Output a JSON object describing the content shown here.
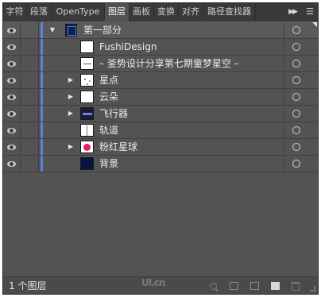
{
  "tabs": [
    {
      "label": "字符",
      "active": false
    },
    {
      "label": "段落",
      "active": false
    },
    {
      "label": "OpenType",
      "active": false
    },
    {
      "label": "图层",
      "active": true
    },
    {
      "label": "画板",
      "active": false
    },
    {
      "label": "变换",
      "active": false
    },
    {
      "label": "对齐",
      "active": false
    },
    {
      "label": "路径查找器",
      "active": false
    }
  ],
  "tab_overflow_icon": "double-chevron-right-icon",
  "panel_menu_icon": "panel-menu-icon",
  "layer_color": "#5c7fe6",
  "layers": [
    {
      "name": "第一部分",
      "level": 0,
      "expanded": true,
      "expandable": true,
      "thumb": "layer-thumb-icon",
      "visible": true
    },
    {
      "name": "FushiDesign",
      "level": 1,
      "expandable": false,
      "thumb": "blank-thumb-icon",
      "visible": true
    },
    {
      "name": "– 釜势设计分享第七期童梦星空 –",
      "level": 1,
      "expandable": false,
      "thumb": "line-thumb-icon",
      "visible": true
    },
    {
      "name": "星点",
      "level": 1,
      "expandable": true,
      "expanded": false,
      "thumb": "dots-thumb-icon",
      "visible": true
    },
    {
      "name": "云朵",
      "level": 1,
      "expandable": true,
      "expanded": false,
      "thumb": "blank-thumb-icon",
      "visible": true
    },
    {
      "name": "飞行器",
      "level": 1,
      "expandable": true,
      "expanded": false,
      "thumb": "ship-thumb-icon",
      "visible": true
    },
    {
      "name": "轨道",
      "level": 1,
      "expandable": false,
      "thumb": "track-thumb-icon",
      "visible": true
    },
    {
      "name": "粉红星球",
      "level": 1,
      "expandable": true,
      "expanded": false,
      "thumb": "planet-thumb-icon",
      "visible": true
    },
    {
      "name": "背景",
      "level": 1,
      "expandable": false,
      "thumb": "bg-thumb-icon",
      "visible": true
    }
  ],
  "footer": {
    "layer_count": "1 个图层",
    "watermark": "UI.cn"
  }
}
